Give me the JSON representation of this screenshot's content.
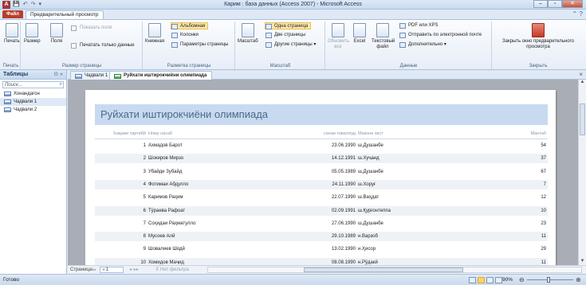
{
  "window": {
    "title": "Карим : база данных (Access 2007) - Microsoft Access",
    "app_icon": "A",
    "qat": [
      "💾",
      "↶",
      "↷",
      "▾"
    ],
    "controls": [
      "–",
      "▫",
      "✕"
    ],
    "help": "⌃ ?"
  },
  "ribbon_tabs": {
    "file": "Файл",
    "active": "Предварительный просмотр"
  },
  "ribbon": {
    "print_group": {
      "label": "Печать",
      "print_btn": "Печать"
    },
    "page_size_group": {
      "label": "Размер страницы",
      "size_btn": "Размер",
      "margins_btn": "Поля",
      "show_margins": "Показать поля",
      "print_data_only": "Печатать только данные"
    },
    "layout_group": {
      "label": "Разметка страницы",
      "portrait_btn": "Книжная",
      "landscape": "Альбомная",
      "columns": "Колонки",
      "page_setup": "Параметры страницы"
    },
    "zoom_group": {
      "label": "Масштаб",
      "zoom_btn": "Масштаб",
      "one_page": "Одна страница",
      "two_pages": "Две страницы",
      "more_pages": "Другие страницы ▾"
    },
    "data_group": {
      "label": "Данные",
      "refresh_btn": "Обновить все",
      "excel_btn": "Excel",
      "text_btn": "Текстовый файл",
      "pdf": "PDF или XPS",
      "email": "Отправить по электронной почте",
      "more": "Дополнительно ▾"
    },
    "close_group": {
      "label": "Закрыть",
      "close_btn": "Закрыть окно предварительного просмотра"
    }
  },
  "nav_pane": {
    "title": "Таблицы",
    "controls": "⊙ «",
    "search_placeholder": "Поиск...",
    "items": [
      {
        "label": "Хонандагон"
      },
      {
        "label": "Чадвали 1"
      },
      {
        "label": "Чадвали 2"
      }
    ]
  },
  "doc_tabs": [
    {
      "label": "Чадвали 1"
    },
    {
      "label": "Руйхати иштирокчиёни олимпиада"
    }
  ],
  "report": {
    "title": "Руйхати иштирокчиёни олимпиада",
    "headers": {
      "num": "Ъақами тартибй",
      "name": "Ному насаб",
      "date": "санаи таваллуд",
      "place": "Макони зист",
      "score": "Мантаб"
    },
    "rows": [
      {
        "num": "1",
        "name": "Ахмадов Барот",
        "date": "23.06.1990",
        "place": "ш.Душанбе",
        "score": "54"
      },
      {
        "num": "2",
        "name": "Шокиров Мирзо",
        "date": "14.12.1991",
        "place": "ш.Хуҷанд",
        "score": "37"
      },
      {
        "num": "3",
        "name": "Убайди Зубайд",
        "date": "05.05.1989",
        "place": "ш.Душанбе",
        "score": "67"
      },
      {
        "num": "4",
        "name": "Фотимаи Абдулло",
        "date": "24.11.1990",
        "place": "ш.Хоруғ",
        "score": "7"
      },
      {
        "num": "5",
        "name": "Каримов Раҳим",
        "date": "22.07.1990",
        "place": "ш.Ваҳдат",
        "score": "12"
      },
      {
        "num": "6",
        "name": "Тӯраева Рафоат",
        "date": "02.09.1991",
        "place": "ш.Қурғонтеппа",
        "score": "10"
      },
      {
        "num": "7",
        "name": "Соҳидаи Раҳматулло",
        "date": "27.06.1990",
        "place": "ш.Душанбе",
        "score": "23"
      },
      {
        "num": "8",
        "name": "Мусоев Алй",
        "date": "29.10.1989",
        "place": "н.Варзоб",
        "score": "11"
      },
      {
        "num": "9",
        "name": "Шовалиев Шодй",
        "date": "13.02.1990",
        "place": "н.Ҳисор",
        "score": "29"
      },
      {
        "num": "10",
        "name": "Хомидов Маҷид",
        "date": "08.08.1990",
        "place": "н.Рӯдакӣ",
        "score": "11"
      }
    ]
  },
  "pagebar": {
    "label": "Страница:",
    "nav_first": "◂◂",
    "nav_prev": "◂",
    "page": "1",
    "nav_next": "▸ ▸▸",
    "filter": "⊼ Нет фильтра"
  },
  "statusbar": {
    "status": "Готово",
    "zoom": "90%"
  }
}
